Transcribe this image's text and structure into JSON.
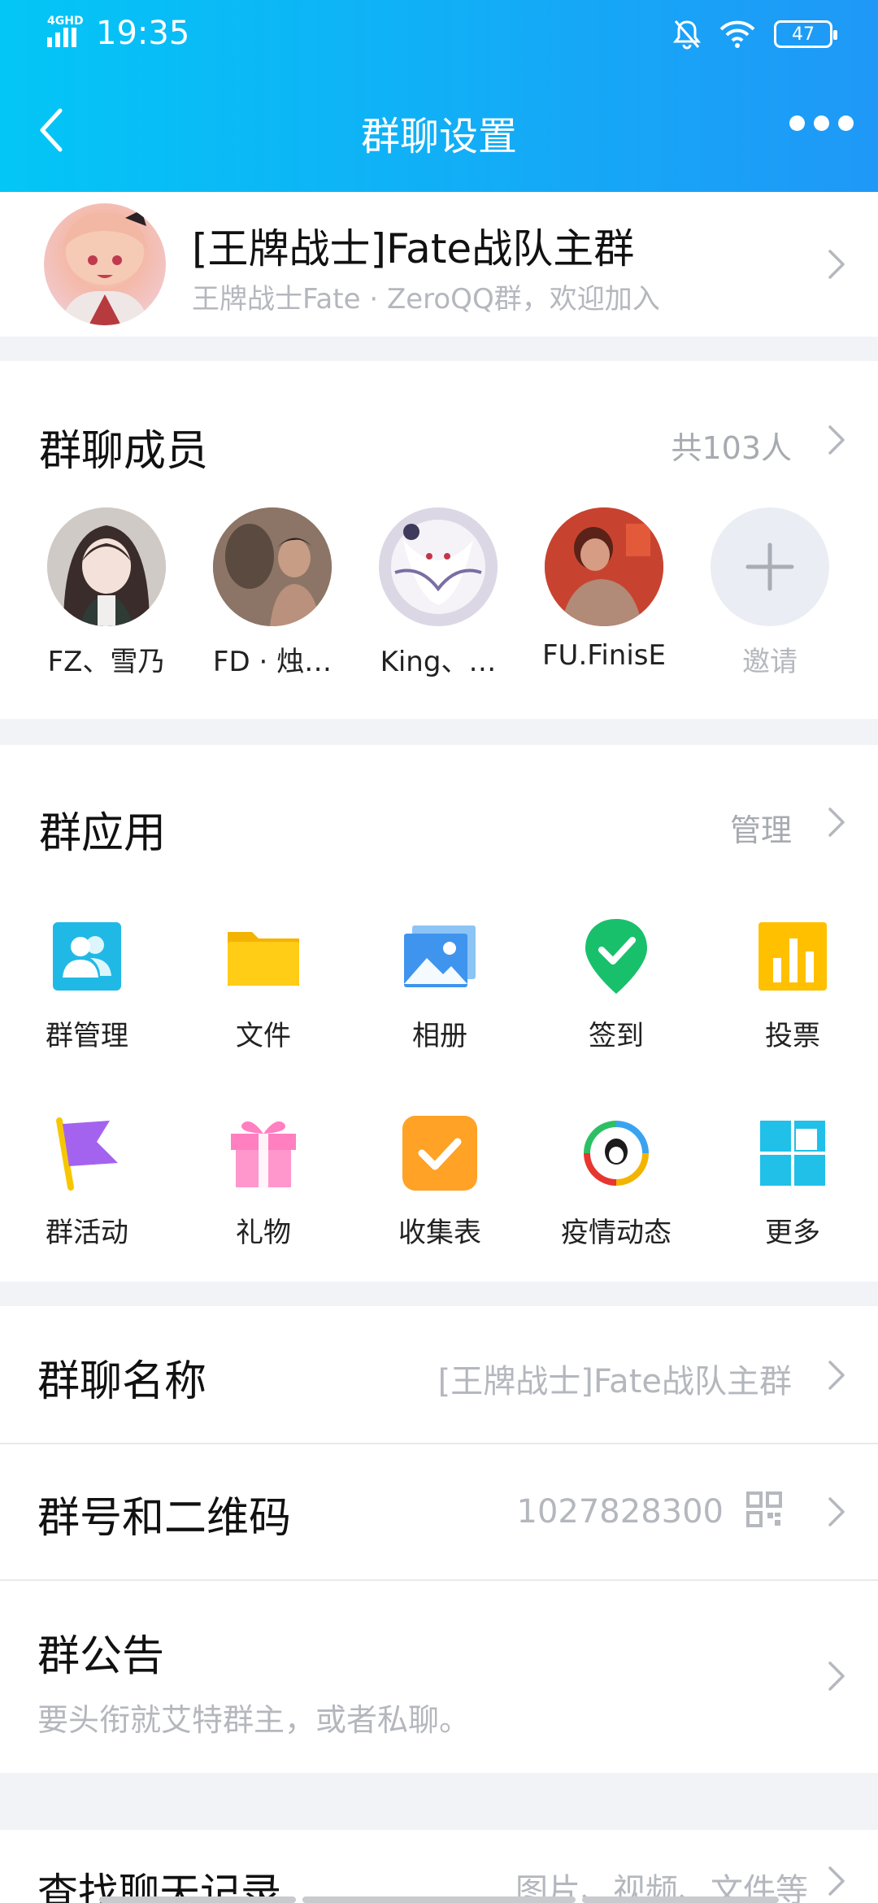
{
  "status_bar": {
    "network": "4GHD",
    "time": "19:35",
    "battery": "47"
  },
  "nav": {
    "title": "群聊设置"
  },
  "group": {
    "name": "[王牌战士]Fate战队主群",
    "description": "王牌战士Fate · ZeroQQ群，欢迎加入"
  },
  "members": {
    "title": "群聊成员",
    "count": "共103人",
    "list": [
      {
        "name": "FZ、雪乃"
      },
      {
        "name": "FD · 烛…"
      },
      {
        "name": "King、…"
      },
      {
        "name": "FU.FinisE"
      }
    ],
    "invite": "邀请"
  },
  "apps": {
    "title": "群应用",
    "manage": "管理",
    "items": [
      {
        "label": "群管理",
        "icon": "group-manage-icon"
      },
      {
        "label": "文件",
        "icon": "folder-icon"
      },
      {
        "label": "相册",
        "icon": "album-icon"
      },
      {
        "label": "签到",
        "icon": "checkin-icon"
      },
      {
        "label": "投票",
        "icon": "vote-icon"
      },
      {
        "label": "群活动",
        "icon": "flag-icon"
      },
      {
        "label": "礼物",
        "icon": "gift-icon"
      },
      {
        "label": "收集表",
        "icon": "form-icon"
      },
      {
        "label": "疫情动态",
        "icon": "epidemic-icon"
      },
      {
        "label": "更多",
        "icon": "more-apps-icon"
      }
    ]
  },
  "settings": {
    "group_name": {
      "label": "群聊名称",
      "value": "[王牌战士]Fate战队主群"
    },
    "group_number": {
      "label": "群号和二维码",
      "value": "1027828300"
    },
    "announcement": {
      "label": "群公告",
      "value": "要头衔就艾特群主，或者私聊。"
    },
    "search_history": {
      "label": "查找聊天记录",
      "value": "图片、视频、文件等"
    }
  },
  "colors": {
    "header_start": "#03c6f6",
    "header_end": "#1f98f7",
    "secondary_text": "#b4b7bd"
  }
}
